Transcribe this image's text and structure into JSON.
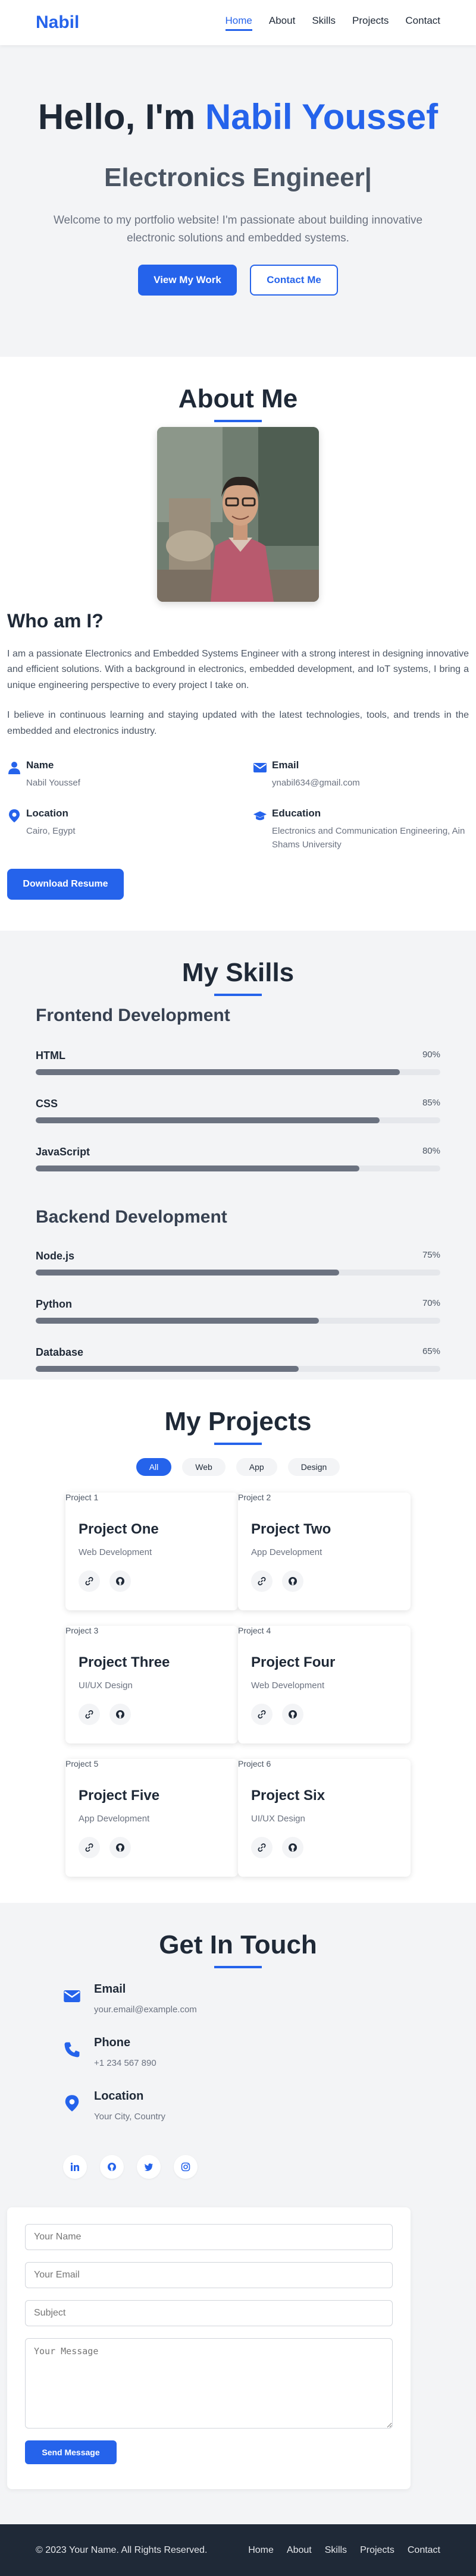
{
  "nav": {
    "logo": "Nabil",
    "links": [
      "Home",
      "About",
      "Skills",
      "Projects",
      "Contact"
    ],
    "active": "Home"
  },
  "hero": {
    "greeting": "Hello, I'm ",
    "name": "Nabil Youssef",
    "role": "Electronics Engineer|",
    "intro": "Welcome to my portfolio website! I'm passionate about building innovative electronic solutions and embedded systems.",
    "primary_button": "View My Work",
    "secondary_button": "Contact Me"
  },
  "about": {
    "title": "About Me",
    "heading": "Who am I?",
    "paragraph1": "I am a passionate Electronics and Embedded Systems Engineer with a strong interest in designing innovative and efficient solutions. With a background in electronics, embedded development, and IoT systems, I bring a unique engineering perspective to every project I take on.",
    "paragraph2": "I believe in continuous learning and staying updated with the latest technologies, tools, and trends in the embedded and electronics industry.",
    "info": [
      {
        "label": "Name",
        "value": "Nabil Youssef",
        "icon": "user-icon"
      },
      {
        "label": "Email",
        "value": "ynabil634@gmail.com",
        "icon": "envelope-icon"
      },
      {
        "label": "Location",
        "value": "Cairo, Egypt",
        "icon": "map-pin-icon"
      },
      {
        "label": "Education",
        "value": "Electronics and Communication Engineering, Ain Shams University",
        "icon": "graduation-cap-icon"
      }
    ],
    "resume_button": "Download Resume"
  },
  "skills": {
    "title": "My Skills",
    "groups": [
      {
        "title": "Frontend Development",
        "items": [
          {
            "name": "HTML",
            "percent_label": "90%",
            "level": 0.9
          },
          {
            "name": "CSS",
            "percent_label": "85%",
            "level": 0.85
          },
          {
            "name": "JavaScript",
            "percent_label": "80%",
            "level": 0.8
          }
        ]
      },
      {
        "title": "Backend Development",
        "items": [
          {
            "name": "Node.js",
            "percent_label": "75%",
            "level": 0.75
          },
          {
            "name": "Python",
            "percent_label": "70%",
            "level": 0.7
          },
          {
            "name": "Database",
            "percent_label": "65%",
            "level": 0.65
          }
        ]
      }
    ]
  },
  "projects": {
    "title": "My Projects",
    "filters": [
      "All",
      "Web",
      "App",
      "Design"
    ],
    "active_filter": "All",
    "items": [
      {
        "alt": "Project 1",
        "title": "Project One",
        "category": "Web Development"
      },
      {
        "alt": "Project 2",
        "title": "Project Two",
        "category": "App Development"
      },
      {
        "alt": "Project 3",
        "title": "Project Three",
        "category": "UI/UX Design"
      },
      {
        "alt": "Project 4",
        "title": "Project Four",
        "category": "Web Development"
      },
      {
        "alt": "Project 5",
        "title": "Project Five",
        "category": "App Development"
      },
      {
        "alt": "Project 6",
        "title": "Project Six",
        "category": "UI/UX Design"
      }
    ]
  },
  "contact": {
    "title": "Get In Touch",
    "items": [
      {
        "label": "Email",
        "value": "your.email@example.com",
        "icon": "envelope-icon"
      },
      {
        "label": "Phone",
        "value": "+1 234 567 890",
        "icon": "phone-icon"
      },
      {
        "label": "Location",
        "value": "Your City, Country",
        "icon": "map-pin-icon"
      }
    ],
    "socials": [
      "linkedin-icon",
      "github-icon",
      "twitter-icon",
      "instagram-icon"
    ],
    "form": {
      "name_placeholder": "Your Name",
      "email_placeholder": "Your Email",
      "subject_placeholder": "Subject",
      "message_placeholder": "Your Message",
      "submit": "Send Message"
    }
  },
  "footer": {
    "copyright": "© 2023 Your Name. All Rights Reserved.",
    "links": [
      "Home",
      "About",
      "Skills",
      "Projects",
      "Contact"
    ]
  },
  "colors": {
    "accent": "#2563eb",
    "dark": "#1f2937",
    "light_bg": "#f3f4f6"
  }
}
